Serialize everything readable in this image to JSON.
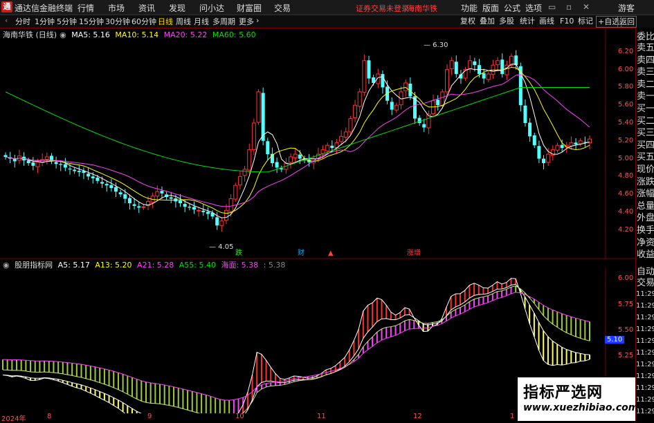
{
  "titlebar": {
    "app_title": "通达信金融终端",
    "menus": [
      "行情",
      "市场",
      "资讯",
      "发现",
      "问小达",
      "财富圈",
      "交易"
    ],
    "warning": "证券交易未登录",
    "stock": "海南华铁",
    "right_menus": [
      "功能",
      "版面",
      "公式",
      "选项"
    ],
    "guest": "游客"
  },
  "tabbar": {
    "tabs": [
      "分时",
      "1分钟",
      "5分钟",
      "15分钟",
      "30分钟",
      "60分钟",
      "日线",
      "周线",
      "月线",
      "多周期",
      "更多"
    ],
    "active_tab": "日线",
    "right_buttons": [
      "复权",
      "叠加",
      "多股",
      "统计",
      "画线",
      "F10",
      "标记",
      "+自选",
      "返回"
    ]
  },
  "main_legend": {
    "stock_label": "海南华铁 (日线)",
    "ma5": "MA5: 5.16",
    "ma10": "MA10: 5.14",
    "ma20": "MA20: 5.22",
    "ma60": "MA60: 5.60"
  },
  "main_chart": {
    "y_ticks": [
      "6.20",
      "6.00",
      "5.80",
      "5.60",
      "5.40",
      "5.20",
      "5.00",
      "4.80",
      "4.60",
      "4.40",
      "4.20"
    ],
    "high_label": "6.30",
    "low_label": "4.05",
    "markers": [
      "跌",
      "财",
      "▲",
      "涨增"
    ]
  },
  "sub_legend": {
    "name": "股朋指标网",
    "a5": "A5: 5.17",
    "a13": "A13: 5.20",
    "a21": "A21: 5.28",
    "a55": "A55: 5.40",
    "haimian": "海面: 5.38",
    "extra": ": 5.38"
  },
  "sub_chart": {
    "y_ticks": [
      "6.00",
      "5.75",
      "5.50",
      "5.25",
      "5.00",
      "4.75"
    ],
    "current_value": "5.10"
  },
  "x_axis": {
    "labels": [
      "2024年",
      "8",
      "9",
      "10",
      "11",
      "12",
      "1"
    ]
  },
  "sidepanel": {
    "top_label": "委比",
    "items": [
      "卖五",
      "卖四",
      "卖三",
      "卖二",
      "卖一",
      "买一",
      "买二",
      "买三",
      "买四",
      "买五",
      "现价",
      "涨跌",
      "涨幅",
      "总量",
      "外盘",
      "换手",
      "净资",
      "收益"
    ],
    "items2": [
      "自动",
      "交易"
    ],
    "times": [
      "11:29",
      "11:29",
      "11:29",
      "11:29",
      "11:29",
      "11:29",
      "11:29",
      "11:29",
      "11:29",
      "11:29",
      "11:29"
    ]
  },
  "watermark": {
    "title": "指标严选网",
    "url": "www.xuezhibiao.com"
  },
  "colors": {
    "up": "#ff3232",
    "down": "#54ffff",
    "ma5": "#ffffff",
    "ma10": "#ffff00",
    "ma20": "#ff40ff",
    "ma60": "#00e000"
  },
  "chart_data": {
    "type": "candlestick",
    "ylim": [
      4.05,
      6.3
    ],
    "closes": [
      5.02,
      5.0,
      4.97,
      5.03,
      4.98,
      4.95,
      4.92,
      4.96,
      4.99,
      5.02,
      4.97,
      4.94,
      4.93,
      4.9,
      4.88,
      4.86,
      4.85,
      4.84,
      4.8,
      4.78,
      4.75,
      4.72,
      4.7,
      4.67,
      4.63,
      4.6,
      4.55,
      4.5,
      4.47,
      4.45,
      4.46,
      4.52,
      4.58,
      4.63,
      4.61,
      4.57,
      4.55,
      4.52,
      4.5,
      4.46,
      4.45,
      4.43,
      4.42,
      4.4,
      4.38,
      4.35,
      4.25,
      4.3,
      4.42,
      4.55,
      4.7,
      4.8,
      4.88,
      5.1,
      5.4,
      5.75,
      5.2,
      5.05,
      4.95,
      4.9,
      4.88,
      4.95,
      5.02,
      5.05,
      5.0,
      4.98,
      4.96,
      5.0,
      5.05,
      5.1,
      5.15,
      5.12,
      5.18,
      5.25,
      5.3,
      5.45,
      5.6,
      5.75,
      6.1,
      5.9,
      5.85,
      5.95,
      5.8,
      5.65,
      5.55,
      5.6,
      5.75,
      5.85,
      5.7,
      5.45,
      5.4,
      5.35,
      5.5,
      5.65,
      5.6,
      5.75,
      6.0,
      6.1,
      5.95,
      5.9,
      6.0,
      6.1,
      6.05,
      5.95,
      5.9,
      5.95,
      6.05,
      6.1,
      5.95,
      6.05,
      6.15,
      6.05,
      5.6,
      5.4,
      5.25,
      5.15,
      5.0,
      4.95,
      5.05,
      5.1,
      5.15,
      5.12,
      5.15,
      5.18,
      5.16,
      5.2,
      5.18,
      5.22
    ]
  }
}
